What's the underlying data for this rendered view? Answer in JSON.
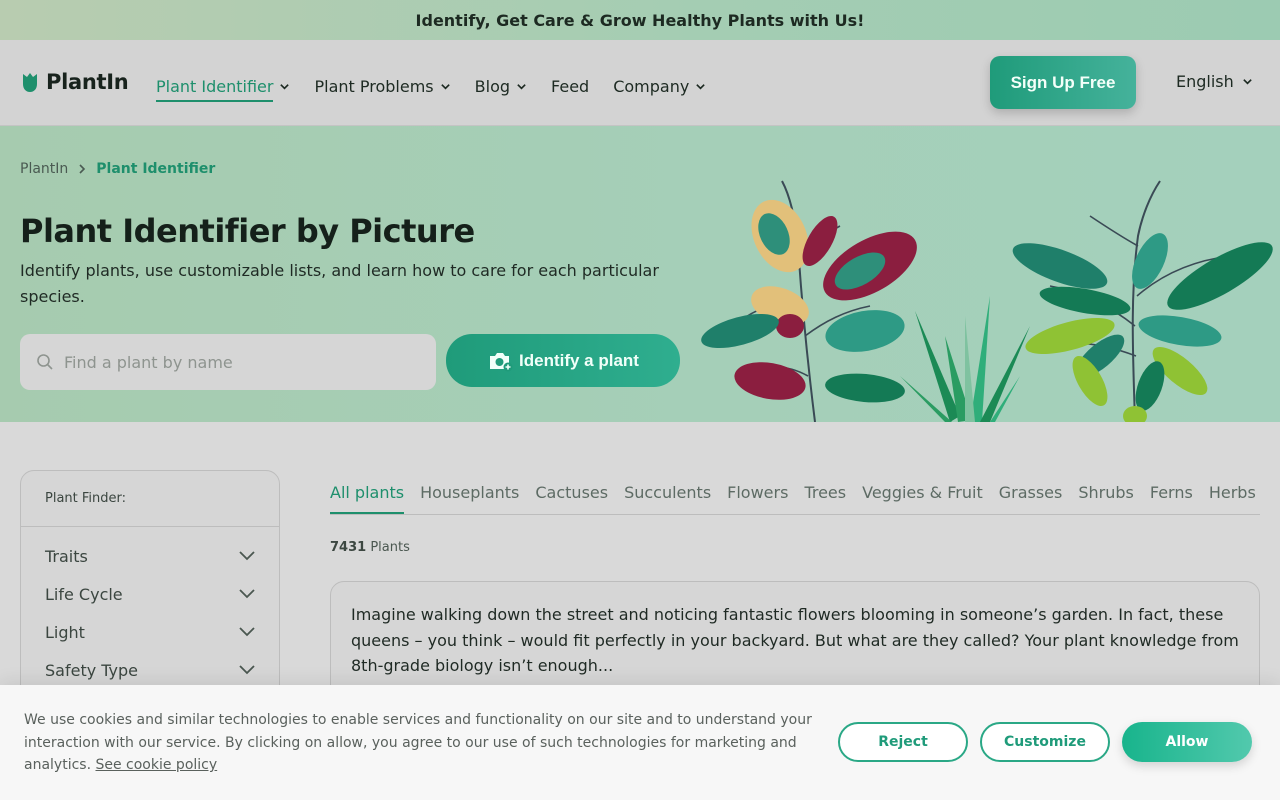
{
  "promo_banner": {
    "text": "Identify, Get Care & Grow Healthy Plants with Us!"
  },
  "header": {
    "logo_text": "PlantIn",
    "nav": [
      {
        "label": "Plant Identifier",
        "has_dropdown": true,
        "active": true
      },
      {
        "label": "Plant Problems",
        "has_dropdown": true
      },
      {
        "label": "Blog",
        "has_dropdown": true
      },
      {
        "label": "Feed",
        "has_dropdown": false
      },
      {
        "label": "Company",
        "has_dropdown": true
      }
    ],
    "signup_label": "Sign Up Free",
    "language": "English"
  },
  "breadcrumb": {
    "home": "PlantIn",
    "current": "Plant Identifier"
  },
  "hero": {
    "title": "Plant Identifier by Picture",
    "subtitle": "Identify plants, use customizable lists, and learn how to care for each particular species.",
    "search_placeholder": "Find a plant by name",
    "identify_label": "Identify a plant"
  },
  "sidebar": {
    "title": "Plant Finder:",
    "filters": [
      "Traits",
      "Life Cycle",
      "Light",
      "Safety Type"
    ]
  },
  "tabs": [
    "All plants",
    "Houseplants",
    "Cactuses",
    "Succulents",
    "Flowers",
    "Trees",
    "Veggies & Fruit",
    "Grasses",
    "Shrubs",
    "Ferns",
    "Herbs"
  ],
  "results": {
    "count": "7431",
    "count_label": " Plants"
  },
  "intro_card": {
    "text": "Imagine walking down the street and noticing fantastic flowers blooming in someone’s garden. In fact, these queens – you think – would fit perfectly in your backyard. But what are they called? Your plant knowledge from 8th-grade biology isn’t enough..."
  },
  "cookie": {
    "text": "We use cookies and similar technologies to enable services and functionality on our site and to understand your interaction with our service. By clicking on allow, you agree to our use of such technologies for marketing and analytics. ",
    "link": "See cookie policy",
    "reject": "Reject",
    "customize": "Customize",
    "allow": "Allow"
  },
  "colors": {
    "accent": "#1e8f6c",
    "hero_bg": "#a5cfb8",
    "button": "#1f9b7a"
  }
}
